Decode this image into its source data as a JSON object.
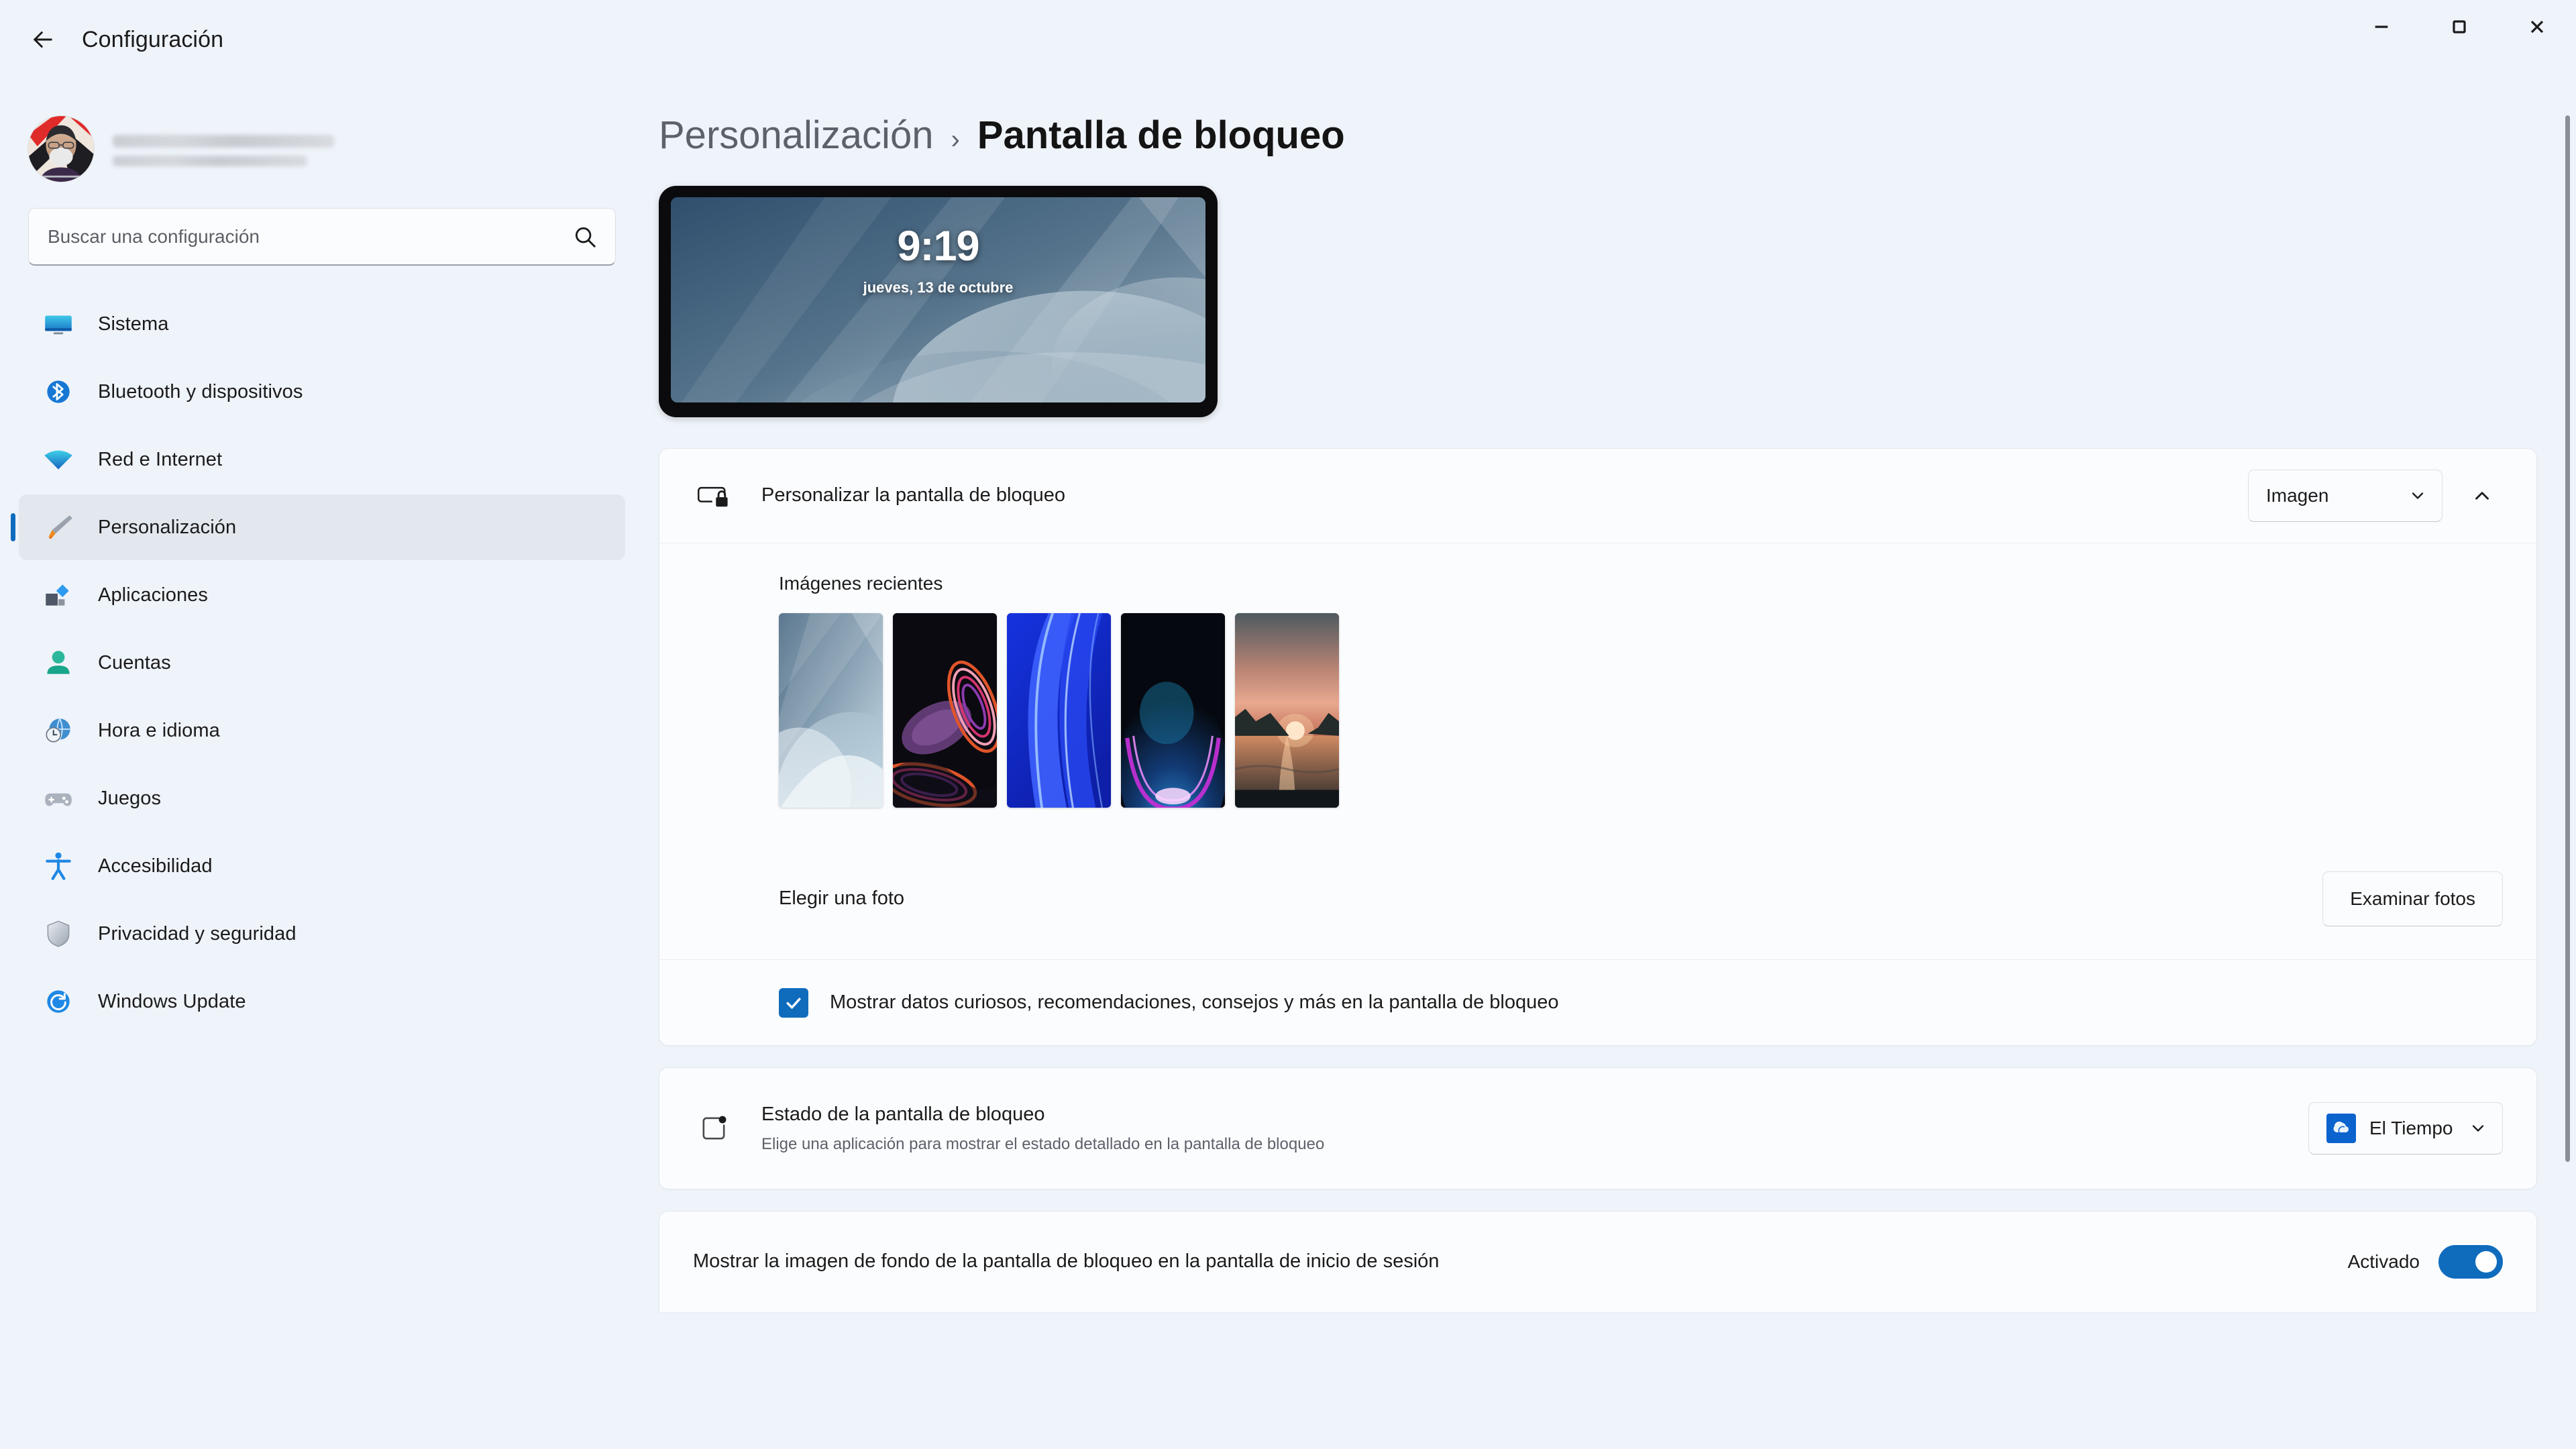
{
  "window": {
    "app_title": "Configuración",
    "back_icon": "arrow-left-icon",
    "minimize_label": "Minimizar",
    "maximize_label": "Maximizar",
    "close_label": "Cerrar"
  },
  "sidebar": {
    "account": {
      "name_redacted": true,
      "avatar_icon": "user-avatar"
    },
    "search": {
      "placeholder": "Buscar una configuración",
      "value": "",
      "icon": "search-icon"
    },
    "items": [
      {
        "label": "Sistema",
        "icon": "monitor-icon",
        "active": false
      },
      {
        "label": "Bluetooth y dispositivos",
        "icon": "bluetooth-icon",
        "active": false
      },
      {
        "label": "Red e Internet",
        "icon": "wifi-icon",
        "active": false
      },
      {
        "label": "Personalización",
        "icon": "paintbrush-icon",
        "active": true
      },
      {
        "label": "Aplicaciones",
        "icon": "apps-icon",
        "active": false
      },
      {
        "label": "Cuentas",
        "icon": "person-icon",
        "active": false
      },
      {
        "label": "Hora e idioma",
        "icon": "clock-globe-icon",
        "active": false
      },
      {
        "label": "Juegos",
        "icon": "gamepad-icon",
        "active": false
      },
      {
        "label": "Accesibilidad",
        "icon": "accessibility-icon",
        "active": false
      },
      {
        "label": "Privacidad y seguridad",
        "icon": "shield-icon",
        "active": false
      },
      {
        "label": "Windows Update",
        "icon": "update-icon",
        "active": false
      }
    ]
  },
  "breadcrumb": {
    "parent": "Personalización",
    "separator": "›",
    "current": "Pantalla de bloqueo"
  },
  "preview": {
    "time": "9:19",
    "date": "jueves, 13 de octubre"
  },
  "settings": {
    "personalize": {
      "icon": "screen-lock-icon",
      "title": "Personalizar la pantalla de bloqueo",
      "value": "Imagen",
      "chevron_icon": "chevron-down-icon",
      "expander_icon": "chevron-up-icon",
      "expanded": true
    },
    "recent_images": {
      "label": "Imágenes recientes",
      "thumbnails": [
        {
          "name": "wallpaper-abstract-blue-grey"
        },
        {
          "name": "wallpaper-dark-purple-swirl"
        },
        {
          "name": "wallpaper-windows-bloom-blue"
        },
        {
          "name": "wallpaper-dark-teal-magenta-arc"
        },
        {
          "name": "wallpaper-sunset-lake"
        }
      ]
    },
    "choose_photo": {
      "label": "Elegir una foto",
      "button_label": "Examinar fotos"
    },
    "fun_facts": {
      "label": "Mostrar datos curiosos, recomendaciones, consejos y más en la pantalla de bloqueo",
      "checked": true,
      "check_icon": "checkmark-icon"
    },
    "lock_status": {
      "icon": "screen-status-icon",
      "title": "Estado de la pantalla de bloqueo",
      "description": "Elige una aplicación para mostrar el estado detallado en la pantalla de bloqueo",
      "value": "El Tiempo",
      "app_icon": "weather-icon",
      "chevron_icon": "chevron-down-icon"
    },
    "signin_background": {
      "title": "Mostrar la imagen de fondo de la pantalla de bloqueo en la pantalla de inicio de sesión",
      "state_label": "Activado",
      "on": true
    }
  },
  "colors": {
    "accent": "#0f6cbd",
    "window_bg": "#eff3fa",
    "card_bg": "#fbfcfe",
    "text_primary": "#1b1b1b",
    "text_secondary": "#5d6169"
  }
}
